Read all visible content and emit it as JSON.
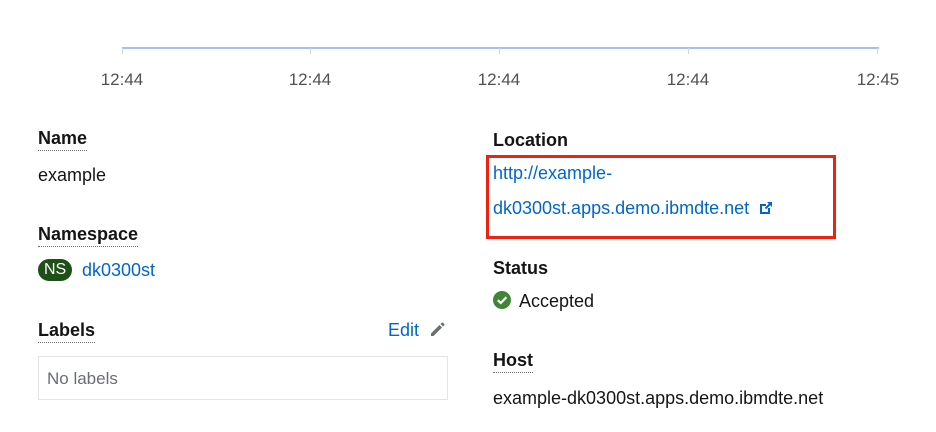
{
  "timeline": {
    "ticks": [
      "12:44",
      "12:44",
      "12:44",
      "12:44",
      "12:45"
    ]
  },
  "details": {
    "name_label": "Name",
    "name_value": "example",
    "namespace_label": "Namespace",
    "namespace_badge": "NS",
    "namespace_value": "dk0300st",
    "labels_label": "Labels",
    "labels_edit": "Edit",
    "labels_empty": "No labels"
  },
  "route": {
    "location_label": "Location",
    "location_line1": "http://example-",
    "location_line2": "dk0300st.apps.demo.ibmdte.net",
    "status_label": "Status",
    "status_value": "Accepted",
    "host_label": "Host",
    "host_value": "example-dk0300st.apps.demo.ibmdte.net"
  },
  "colors": {
    "link": "#0066cc",
    "success": "#3e8635",
    "highlight": "#ee2211",
    "ns_badge": "#1e4f18"
  },
  "icons": {
    "edit": "pencil-icon",
    "external": "external-link-icon",
    "status": "check-circle-icon"
  }
}
